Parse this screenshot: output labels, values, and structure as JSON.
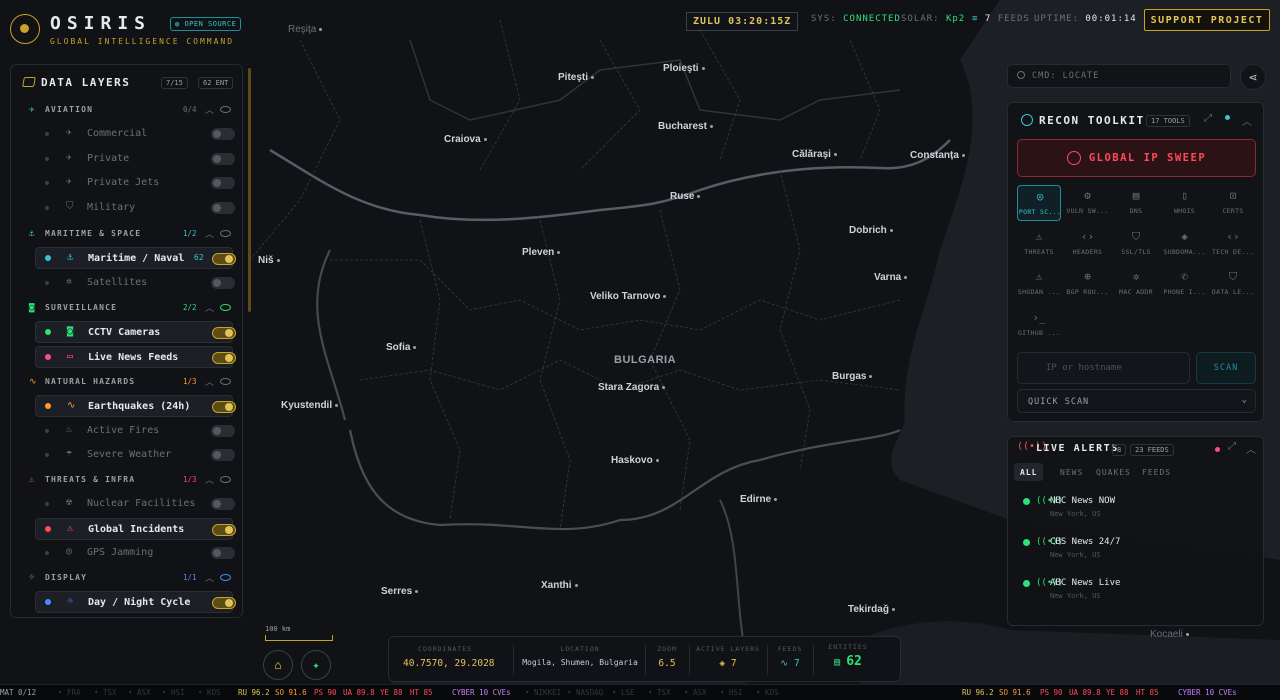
{
  "header": {
    "brand": "OSIRIS",
    "subtitle": "GLOBAL INTELLIGENCE COMMAND",
    "badge": "OPEN SOURCE",
    "zulu": "ZULU 03:20:15Z",
    "sys_label": "SYS:",
    "sys_value": "CONNECTED",
    "solar_label": "SOLAR:",
    "solar_value": "Kp2",
    "signal_count": "7",
    "feeds_label": "FEEDS",
    "uptime_label": "UPTIME:",
    "uptime_value": "00:01:14",
    "support_label": "SUPPORT PROJECT"
  },
  "map": {
    "cities": [
      {
        "name": "Resita",
        "label": "Reşiţa",
        "dim": true
      },
      {
        "name": "Pitesti",
        "label": "Piteşti",
        "dim": false
      },
      {
        "name": "Ploiesti",
        "label": "Ploieşti",
        "dim": false
      },
      {
        "name": "Craiova",
        "label": "Craiova",
        "dim": false
      },
      {
        "name": "Bucharest",
        "label": "Bucharest",
        "dim": false
      },
      {
        "name": "Calarasi",
        "label": "Călăraşi",
        "dim": false
      },
      {
        "name": "Constanta",
        "label": "Constanța",
        "dim": false
      },
      {
        "name": "Ruse",
        "label": "Ruse",
        "dim": false
      },
      {
        "name": "Dobrich",
        "label": "Dobrich",
        "dim": false
      },
      {
        "name": "Pleven",
        "label": "Pleven",
        "dim": false
      },
      {
        "name": "Nis",
        "label": "Niš",
        "dim": false
      },
      {
        "name": "Varna",
        "label": "Varna",
        "dim": false
      },
      {
        "name": "Veliko-Tarnovo",
        "label": "Veliko Tarnovo",
        "dim": false
      },
      {
        "name": "Sofia",
        "label": "Sofia",
        "dim": false
      },
      {
        "name": "Stara-Zagora",
        "label": "Stara Zagora",
        "dim": false
      },
      {
        "name": "Burgas",
        "label": "Burgas",
        "dim": false
      },
      {
        "name": "Kyustendil",
        "label": "Kyustendil",
        "dim": false
      },
      {
        "name": "Haskovo",
        "label": "Haskovo",
        "dim": false
      },
      {
        "name": "Edirne",
        "label": "Edirne",
        "dim": false
      },
      {
        "name": "Xanthi",
        "label": "Xanthi",
        "dim": false
      },
      {
        "name": "Serres",
        "label": "Serres",
        "dim": false
      },
      {
        "name": "Tekirdag",
        "label": "Tekirdağ",
        "dim": false
      },
      {
        "name": "Kocaeli",
        "label": "Kocaeli",
        "dim": true
      }
    ],
    "country": "BULGARIA",
    "scale": "100 km"
  },
  "left_panel": {
    "title": "DATA LAYERS",
    "active_count": "7/15",
    "entity_count": "62 ENT",
    "groups": [
      {
        "title": "AVIATION",
        "count": "0/4",
        "color": "#6b6f77",
        "icon_color": "#35c6d1",
        "eye_on": false,
        "items": [
          {
            "label": "Commercial",
            "on": false,
            "count": "",
            "dot": "#3a3f47"
          },
          {
            "label": "Private",
            "on": false,
            "count": "",
            "dot": "#3a3f47"
          },
          {
            "label": "Private Jets",
            "on": false,
            "count": "",
            "dot": "#3a3f47"
          },
          {
            "label": "Military",
            "on": false,
            "count": "",
            "dot": "#3a3f47"
          }
        ]
      },
      {
        "title": "MARITIME & SPACE",
        "count": "1/2",
        "color": "#35c6d1",
        "icon_color": "#35c6d1",
        "eye_on": false,
        "items": [
          {
            "label": "Maritime / Naval",
            "on": true,
            "count": "62",
            "dot": "#35c6d1"
          },
          {
            "label": "Satellites",
            "on": false,
            "count": "",
            "dot": "#3a3f47"
          }
        ]
      },
      {
        "title": "SURVEILLANCE",
        "count": "2/2",
        "color": "#2ee07a",
        "icon_color": "#2ee07a",
        "eye_on": true,
        "items": [
          {
            "label": "CCTV Cameras",
            "on": true,
            "count": "",
            "dot": "#2ee07a"
          },
          {
            "label": "Live News Feeds",
            "on": true,
            "count": "",
            "dot": "#ff4a8a"
          }
        ]
      },
      {
        "title": "NATURAL HAZARDS",
        "count": "1/3",
        "color": "#ff9a2e",
        "icon_color": "#ff9a2e",
        "eye_on": false,
        "items": [
          {
            "label": "Earthquakes (24h)",
            "on": true,
            "count": "",
            "dot": "#ff9a2e"
          },
          {
            "label": "Active Fires",
            "on": false,
            "count": "",
            "dot": "#3a3f47"
          },
          {
            "label": "Severe Weather",
            "on": false,
            "count": "",
            "dot": "#3a3f47"
          }
        ]
      },
      {
        "title": "THREATS & INFRA",
        "count": "1/3",
        "color": "#ff4a5a",
        "icon_color": "#ff4a5a",
        "eye_on": false,
        "items": [
          {
            "label": "Nuclear Facilities",
            "on": false,
            "count": "",
            "dot": "#3a3f47"
          },
          {
            "label": "Global Incidents",
            "on": true,
            "count": "",
            "dot": "#ff4a5a"
          },
          {
            "label": "GPS Jamming",
            "on": false,
            "count": "",
            "dot": "#3a3f47"
          }
        ]
      },
      {
        "title": "DISPLAY",
        "count": "1/1",
        "color": "#4a8cff",
        "icon_color": "#4a8cff",
        "eye_on": true,
        "items": [
          {
            "label": "Day / Night Cycle",
            "on": true,
            "count": "",
            "dot": "#4a8cff"
          }
        ]
      }
    ]
  },
  "right": {
    "cmd_placeholder": "CMD: LOCATE",
    "recon": {
      "title": "RECON TOOLKIT",
      "tools_badge": "17 TOOLS",
      "sweep_label": "GLOBAL IP SWEEP",
      "tools": [
        {
          "label": "PORT SC...",
          "icon": "◎",
          "selected": true
        },
        {
          "label": "VULN SW...",
          "icon": "⚙",
          "selected": false
        },
        {
          "label": "DNS",
          "icon": "▤",
          "selected": false
        },
        {
          "label": "WHOIS",
          "icon": "▯",
          "selected": false
        },
        {
          "label": "CERTS",
          "icon": "⊡",
          "selected": false
        },
        {
          "label": "THREATS",
          "icon": "⚠",
          "selected": false
        },
        {
          "label": "HEADERS",
          "icon": "‹›",
          "selected": false
        },
        {
          "label": "SSL/TLS",
          "icon": "⛉",
          "selected": false
        },
        {
          "label": "SUBDOMA...",
          "icon": "◈",
          "selected": false
        },
        {
          "label": "TECH DE...",
          "icon": "‹›",
          "selected": false
        },
        {
          "label": "SHODAN ...",
          "icon": "⚠",
          "selected": false
        },
        {
          "label": "BGP ROU...",
          "icon": "⊕",
          "selected": false
        },
        {
          "label": "MAC ADDR",
          "icon": "✲",
          "selected": false
        },
        {
          "label": "PHONE I...",
          "icon": "✆",
          "selected": false
        },
        {
          "label": "DATA LE...",
          "icon": "⛉",
          "selected": false
        },
        {
          "label": "GITHUB ...",
          "icon": "›_",
          "selected": false
        }
      ],
      "ip_placeholder": "IP or hostname",
      "scan_label": "SCAN",
      "mode": "QUICK SCAN"
    },
    "alerts": {
      "title": "LIVE ALERTS",
      "count": "8",
      "feeds_badge": "23 FEEDS",
      "tabs": [
        "ALL",
        "NEWS",
        "QUAKES",
        "FEEDS"
      ],
      "items": [
        {
          "name": "NBC News NOW",
          "location": "New York, US"
        },
        {
          "name": "CBS News 24/7",
          "location": "New York, US"
        },
        {
          "name": "ABC News Live",
          "location": "New York, US"
        }
      ]
    }
  },
  "infobar": {
    "coords_label": "COORDINATES",
    "coords_value": "40.7570, 29.2028",
    "location_label": "LOCATION",
    "location_value": "Mogila, Shumen, Bulgaria",
    "zoom_label": "ZOOM",
    "zoom_value": "6.5",
    "layers_label": "ACTIVE LAYERS",
    "layers_value": "7",
    "feeds_label": "FEEDS",
    "feeds_value": "7",
    "entities_label": "ENTITIES",
    "entities_value": "62"
  },
  "ticker": {
    "items": [
      {
        "text": "MAT 0/12",
        "color": "#9aa0a8"
      },
      {
        "text": "• FRA",
        "color": "#33363c"
      },
      {
        "text": "• TSX",
        "color": "#33363c"
      },
      {
        "text": "• ASX",
        "color": "#33363c"
      },
      {
        "text": "• HSI",
        "color": "#33363c"
      },
      {
        "text": "• KOS",
        "color": "#33363c"
      },
      {
        "text": "RU 96.2",
        "color": "#e0c45a"
      },
      {
        "text": "SO 91.6",
        "color": "#ff9a2e"
      },
      {
        "text": "PS 90",
        "color": "#ff4a5a"
      },
      {
        "text": "UA 89.8",
        "color": "#ff4a5a"
      },
      {
        "text": "YE 88",
        "color": "#ff4a5a"
      },
      {
        "text": "HT 85",
        "color": "#ff4a5a"
      },
      {
        "text": "CYBER 10 CVEs",
        "color": "#c77dff"
      },
      {
        "text": "• NIKKEI",
        "color": "#33363c"
      },
      {
        "text": "• NASDAQ",
        "color": "#33363c"
      },
      {
        "text": "• LSE",
        "color": "#33363c"
      },
      {
        "text": "• TSX",
        "color": "#33363c"
      },
      {
        "text": "• ASX",
        "color": "#33363c"
      },
      {
        "text": "• HSI",
        "color": "#33363c"
      },
      {
        "text": "• KOS",
        "color": "#33363c"
      },
      {
        "text": "RU 96.2",
        "color": "#e0c45a"
      },
      {
        "text": "SO 91.6",
        "color": "#ff9a2e"
      },
      {
        "text": "PS 90",
        "color": "#ff4a5a"
      },
      {
        "text": "UA 89.8",
        "color": "#ff4a5a"
      },
      {
        "text": "YE 88",
        "color": "#ff4a5a"
      },
      {
        "text": "HT 85",
        "color": "#ff4a5a"
      },
      {
        "text": "CYBER 10 CVEs",
        "color": "#c77dff"
      }
    ]
  }
}
